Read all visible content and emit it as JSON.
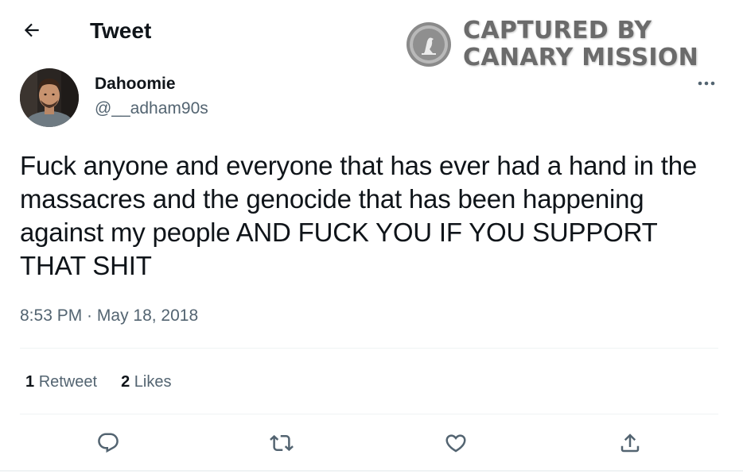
{
  "header": {
    "title": "Tweet",
    "back_icon": "arrow-left-icon"
  },
  "watermark": {
    "line1": "CAPTURED BY",
    "line2": "CANARY MISSION",
    "logo_icon": "canary-bird-icon"
  },
  "author": {
    "display_name": "Dahoomie",
    "handle": "@__adham90s"
  },
  "tweet": {
    "text": "Fuck anyone and everyone that has ever had a hand in the massacres and the genocide that has been happening against my people AND FUCK YOU IF YOU SUPPORT THAT SHIT",
    "time": "8:53 PM",
    "separator": " · ",
    "date": "May 18, 2018"
  },
  "stats": {
    "retweets_count": "1",
    "retweets_label": "Retweet",
    "likes_count": "2",
    "likes_label": "Likes"
  },
  "actions": {
    "reply_icon": "reply-icon",
    "retweet_icon": "retweet-icon",
    "like_icon": "heart-icon",
    "share_icon": "share-icon"
  },
  "colors": {
    "primary_text": "#0f1419",
    "secondary_text": "#536471",
    "divider": "#eff3f4",
    "watermark": "#6b6b6b"
  }
}
